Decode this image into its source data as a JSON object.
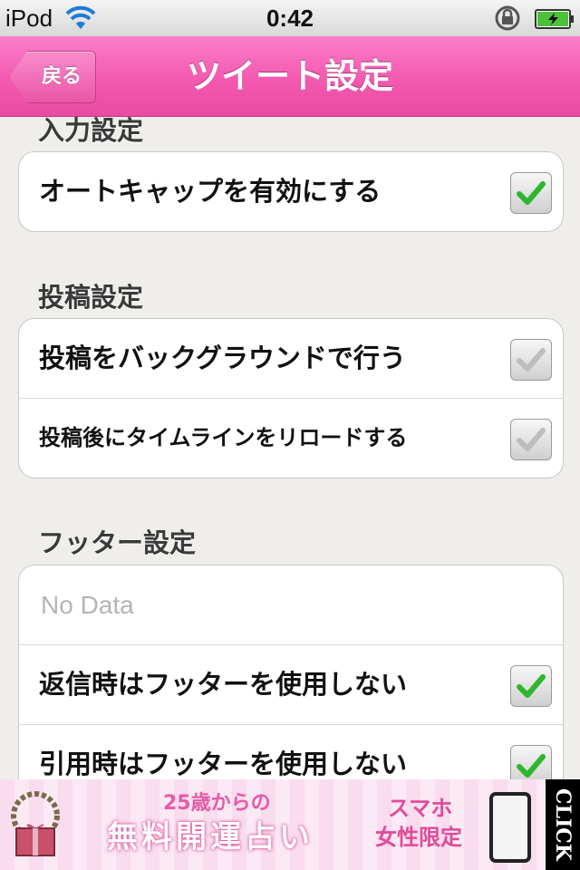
{
  "status_bar": {
    "carrier": "iPod",
    "time": "0:42"
  },
  "nav": {
    "back_label": "戻る",
    "title": "ツイート設定"
  },
  "sections": {
    "input": {
      "title": "入力設定",
      "rows": [
        {
          "label": "オートキャップを有効にする",
          "checked": true,
          "enabled": true
        }
      ]
    },
    "post": {
      "title": "投稿設定",
      "rows": [
        {
          "label": "投稿をバックグラウンドで行う",
          "checked": true,
          "enabled": false
        },
        {
          "label": "投稿後にタイムラインをリロードする",
          "checked": true,
          "enabled": false
        }
      ]
    },
    "footer": {
      "title": "フッター設定",
      "placeholder": "No Data",
      "rows": [
        {
          "label": "返信時はフッターを使用しない",
          "checked": true,
          "enabled": true
        },
        {
          "label": "引用時はフッターを使用しない",
          "checked": true,
          "enabled": true
        }
      ]
    }
  },
  "ad": {
    "line1": "25歳からの",
    "line2": "無料開運占い",
    "line3": "スマホ",
    "line4": "女性限定",
    "click": "CLICK"
  },
  "colors": {
    "navbar": "#f359b0",
    "check_enabled": "#2fb52f",
    "check_disabled": "#bdbdbd"
  }
}
